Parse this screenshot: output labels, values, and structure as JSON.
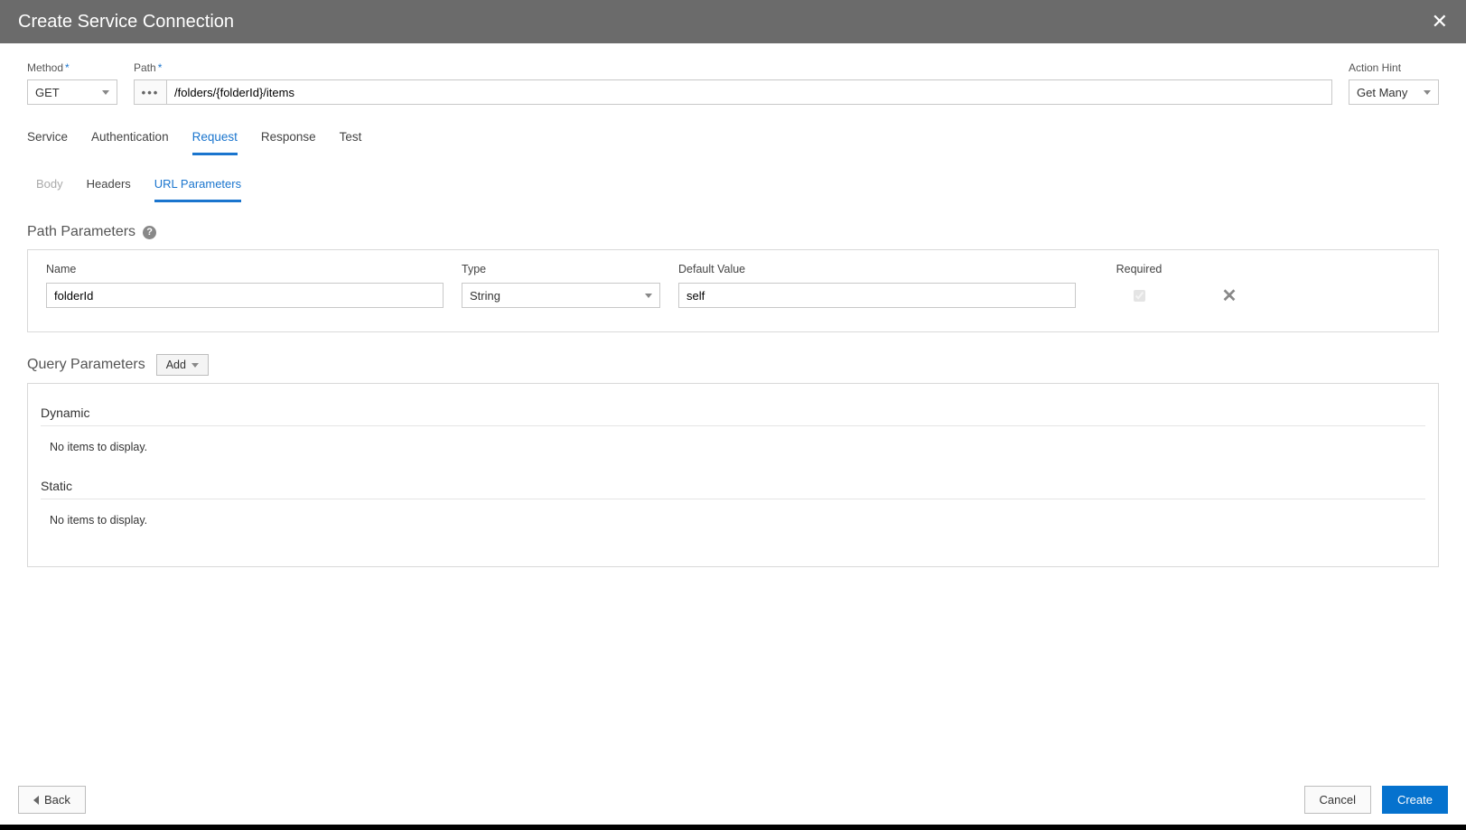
{
  "dialog": {
    "title": "Create Service Connection"
  },
  "top": {
    "method_label": "Method",
    "method_value": "GET",
    "path_label": "Path",
    "path_prefix": "•••",
    "path_value": "/folders/{folderId}/items",
    "action_hint_label": "Action Hint",
    "action_hint_value": "Get Many"
  },
  "tabs": {
    "service": "Service",
    "authentication": "Authentication",
    "request": "Request",
    "response": "Response",
    "test": "Test"
  },
  "subtabs": {
    "body": "Body",
    "headers": "Headers",
    "url_parameters": "URL Parameters"
  },
  "path_params": {
    "title": "Path Parameters",
    "columns": {
      "name": "Name",
      "type": "Type",
      "default_value": "Default Value",
      "required": "Required"
    },
    "row": {
      "name": "folderId",
      "type": "String",
      "default_value": "self",
      "required_checked": "true"
    }
  },
  "query_params": {
    "title": "Query Parameters",
    "add_label": "Add",
    "dynamic_title": "Dynamic",
    "dynamic_empty": "No items to display.",
    "static_title": "Static",
    "static_empty": "No items to display."
  },
  "footer": {
    "back": "Back",
    "cancel": "Cancel",
    "create": "Create"
  }
}
